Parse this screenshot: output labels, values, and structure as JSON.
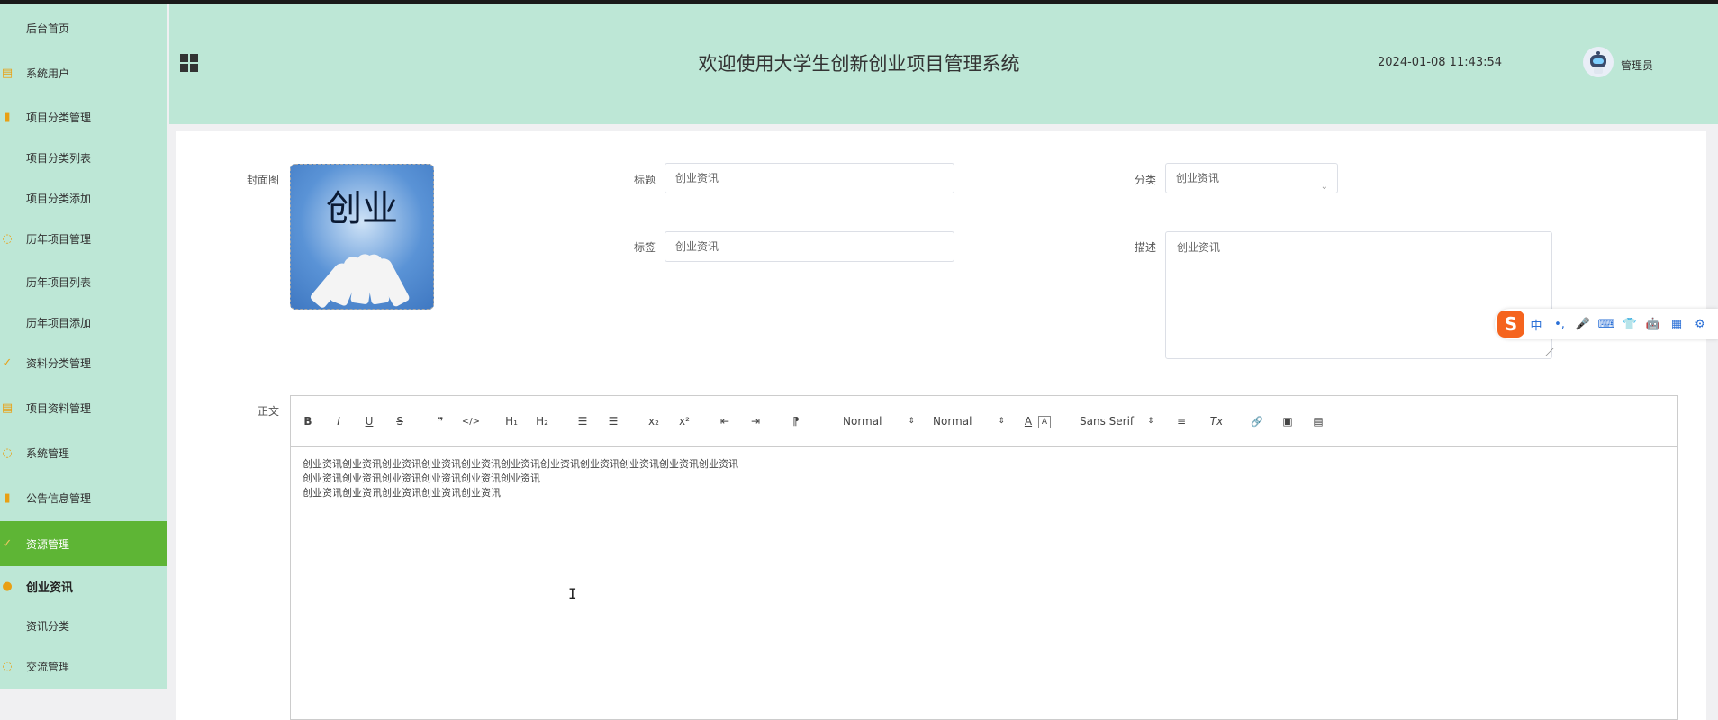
{
  "sidebar": {
    "items": [
      {
        "label": "后台首页",
        "icon": "none"
      },
      {
        "label": "系统用户",
        "icon": "list-icon"
      },
      {
        "label": "项目分类管理",
        "icon": "bar-chart-icon"
      },
      {
        "label": "项目分类列表",
        "icon": "none"
      },
      {
        "label": "项目分类添加",
        "icon": "none"
      },
      {
        "label": "历年项目管理",
        "icon": "chat-icon"
      },
      {
        "label": "历年项目列表",
        "icon": "none"
      },
      {
        "label": "历年项目添加",
        "icon": "none"
      },
      {
        "label": "资料分类管理",
        "icon": "check-circle-icon"
      },
      {
        "label": "项目资料管理",
        "icon": "list-icon"
      },
      {
        "label": "系统管理",
        "icon": "chat-icon"
      },
      {
        "label": "公告信息管理",
        "icon": "bar-chart-icon"
      },
      {
        "label": "资源管理",
        "icon": "check-circle-icon"
      },
      {
        "label": "创业资讯",
        "icon": "location-icon"
      },
      {
        "label": "资讯分类",
        "icon": "none"
      },
      {
        "label": "交流管理",
        "icon": "chat-icon"
      }
    ]
  },
  "header": {
    "title": "欢迎使用大学生创新创业项目管理系统",
    "datetime": "2024-01-08 11:43:54",
    "user": "管理员"
  },
  "form": {
    "cover_label": "封面图",
    "cover_text": "创业",
    "title_label": "标题",
    "title_value": "创业资讯",
    "category_label": "分类",
    "category_value": "创业资讯",
    "tags_label": "标签",
    "tags_value": "创业资讯",
    "desc_label": "描述",
    "desc_value": "创业资讯",
    "body_label": "正文"
  },
  "editor": {
    "toolbar": {
      "bold": "B",
      "italic": "I",
      "underline": "U",
      "strike": "S",
      "quote": "❞",
      "code": "</>",
      "h1": "H₁",
      "h2": "H₂",
      "ordered_list": "☰",
      "bullet_list": "☰",
      "sub": "x₂",
      "sup": "x²",
      "outdent": "⇤",
      "indent": "⇥",
      "direction": "⁋",
      "size_select": "Normal",
      "header_select": "Normal",
      "font_color": "A",
      "bg_color": "A",
      "font_select": "Sans Serif",
      "align": "≡",
      "clean": "Tx",
      "link": "🔗",
      "image": "▣",
      "video": "▤"
    },
    "lines": [
      "创业资讯创业资讯创业资讯创业资讯创业资讯创业资讯创业资讯创业资讯创业资讯创业资讯创业资讯",
      "创业资讯创业资讯创业资讯创业资讯创业资讯创业资讯",
      "创业资讯创业资讯创业资讯创业资讯创业资讯"
    ]
  },
  "ime": {
    "items": [
      "中",
      "•,",
      "🎤",
      "⌨",
      "👕",
      "🤖",
      "▦",
      "⚙"
    ]
  },
  "colors": {
    "sidebar_bg": "#bde7d6",
    "active_bg": "#5eb535",
    "icon_orange": "#e9a014"
  }
}
